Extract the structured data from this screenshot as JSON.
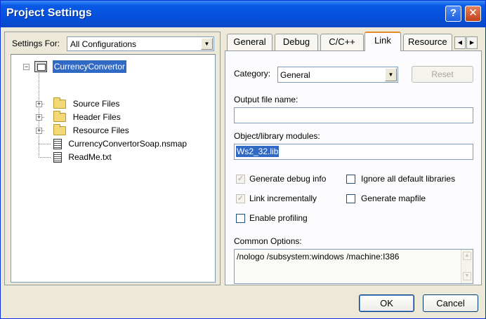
{
  "window": {
    "title": "Project Settings",
    "help": "?",
    "close": "✕"
  },
  "left": {
    "settings_for_label": "Settings For:",
    "config": "All Configurations",
    "tree": {
      "root": "CurrencyConvertor",
      "children": [
        "Source Files",
        "Header Files",
        "Resource Files",
        "CurrencyConvertorSoap.nsmap",
        "ReadMe.txt"
      ]
    }
  },
  "tabs": [
    "General",
    "Debug",
    "C/C++",
    "Link",
    "Resource"
  ],
  "active_tab": "Link",
  "link": {
    "category_label": "Category:",
    "category_value": "General",
    "reset_label": "Reset",
    "output_file_label": "Output file name:",
    "output_file_value": "",
    "modules_label": "Object/library modules:",
    "modules_value": "Ws2_32.lib",
    "checkboxes": {
      "generate_debug_info": {
        "label": "Generate debug info",
        "checked": true,
        "disabled": true
      },
      "ignore_default_libs": {
        "label": "Ignore all default libraries",
        "checked": false
      },
      "link_incrementally": {
        "label": "Link incrementally",
        "checked": true,
        "disabled": true
      },
      "generate_mapfile": {
        "label": "Generate mapfile",
        "checked": false
      },
      "enable_profiling": {
        "label": "Enable profiling",
        "checked": false
      }
    },
    "common_options_label": "Common Options:",
    "common_options_value": "/nologo /subsystem:windows /machine:I386"
  },
  "buttons": {
    "ok": "OK",
    "cancel": "Cancel"
  },
  "colors": {
    "title_bar": "#0550dc",
    "selection": "#316ac5",
    "active_tab_accent": "#e68b2c"
  },
  "icons": {
    "root": "project-icon",
    "folder": "folder-icon",
    "file": "file-icon"
  }
}
